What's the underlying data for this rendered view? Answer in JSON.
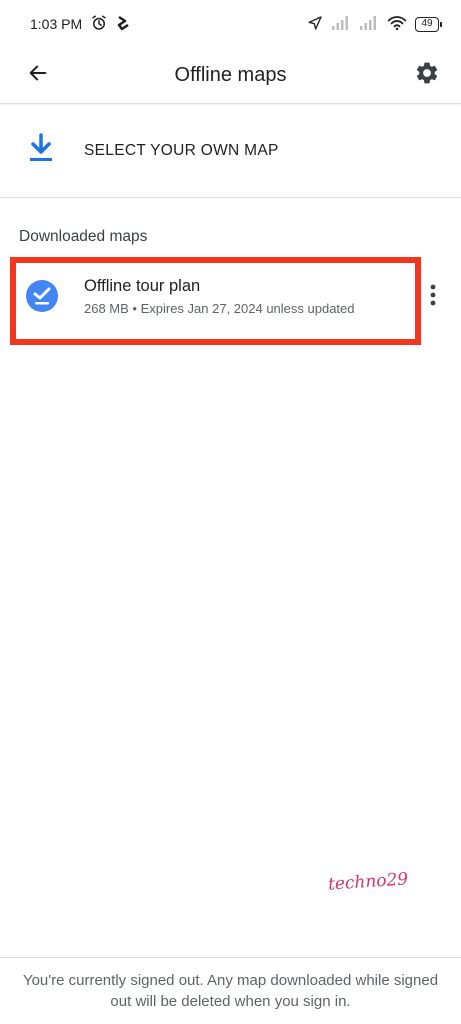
{
  "status_bar": {
    "time": "1:03 PM",
    "left_icons": [
      "alarm-icon",
      "app-notification-icon"
    ],
    "right_icons": [
      "location-icon",
      "signal-icon",
      "signal-icon",
      "wifi-icon"
    ],
    "battery": "49"
  },
  "app_bar": {
    "title": "Offline maps",
    "back_icon": "arrow-left-icon",
    "settings_icon": "gear-icon"
  },
  "select_map": {
    "label": "SELECT YOUR OWN MAP",
    "icon": "download-icon",
    "accent_color": "#1a73e8"
  },
  "downloaded": {
    "section_label": "Downloaded maps",
    "items": [
      {
        "title": "Offline tour plan",
        "subtitle": "268 MB • Expires Jan 27, 2024 unless updated",
        "status_icon": "check-circle-icon"
      }
    ],
    "highlight_color": "#f3361e"
  },
  "signature": "techno29",
  "footer": {
    "message": "You're currently signed out. Any map downloaded while signed out will be deleted when you sign in."
  }
}
